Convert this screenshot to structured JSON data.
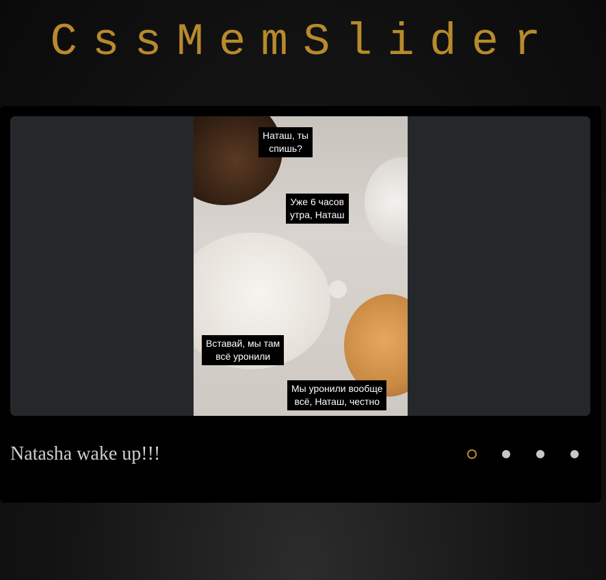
{
  "header": {
    "title": "CssMemSlider"
  },
  "slide": {
    "caption": "Natasha wake up!!!",
    "meme_text": [
      "Наташ, ты\nспишь?",
      "Уже 6 часов\nутра, Наташ",
      "Вставай, мы там\nвсё уронили",
      "Мы уронили вообще\nвсё, Наташ, честно"
    ]
  },
  "pagination": {
    "count": 4,
    "active_index": 0
  },
  "colors": {
    "accent": "#b88a2c",
    "slider_bg": "#000000",
    "stage_bg": "#25282b",
    "dot": "#c7c7c7"
  }
}
